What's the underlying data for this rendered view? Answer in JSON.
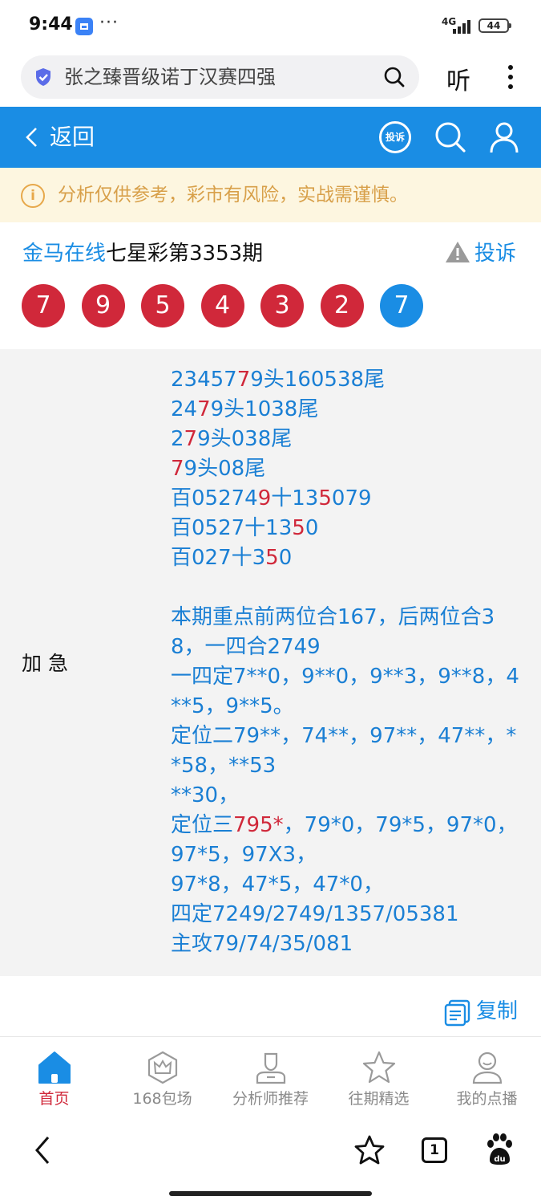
{
  "status_bar": {
    "time": "9:44",
    "dots": "···",
    "network": "4G",
    "battery": "44"
  },
  "browser": {
    "search_text": "张之臻晋级诺丁汉赛四强",
    "listen_label": "听"
  },
  "header": {
    "back_label": "返回",
    "complain_badge": "投诉"
  },
  "notice": {
    "text": "分析仅供参考，彩市有风险，实战需谨慎。"
  },
  "issue": {
    "site": "金马在线",
    "title": "七星彩第3353期",
    "complain_label": "投诉"
  },
  "balls": [
    {
      "number": "7",
      "color": "red"
    },
    {
      "number": "9",
      "color": "red"
    },
    {
      "number": "5",
      "color": "red"
    },
    {
      "number": "4",
      "color": "red"
    },
    {
      "number": "3",
      "color": "red"
    },
    {
      "number": "2",
      "color": "red"
    },
    {
      "number": "7",
      "color": "blue"
    }
  ],
  "panel": {
    "label": "加急",
    "lines": [
      {
        "segments": [
          {
            "text": "23457",
            "red": false
          },
          {
            "text": "7",
            "red": true
          },
          {
            "text": "9头160538尾",
            "red": false
          }
        ]
      },
      {
        "segments": [
          {
            "text": "24",
            "red": false
          },
          {
            "text": "7",
            "red": true
          },
          {
            "text": "9头1038尾",
            "red": false
          }
        ]
      },
      {
        "segments": [
          {
            "text": "2",
            "red": false
          },
          {
            "text": "7",
            "red": true
          },
          {
            "text": "9头038尾",
            "red": false
          }
        ]
      },
      {
        "segments": [
          {
            "text": "7",
            "red": true
          },
          {
            "text": "9头08尾",
            "red": false
          }
        ]
      },
      {
        "segments": [
          {
            "text": "百05274",
            "red": false
          },
          {
            "text": "9",
            "red": true
          },
          {
            "text": "十13",
            "red": false
          },
          {
            "text": "5",
            "red": true
          },
          {
            "text": "079",
            "red": false
          }
        ]
      },
      {
        "segments": [
          {
            "text": "百0527十13",
            "red": false
          },
          {
            "text": "5",
            "red": true
          },
          {
            "text": "0",
            "red": false
          }
        ]
      },
      {
        "segments": [
          {
            "text": "百027十3",
            "red": false
          },
          {
            "text": "5",
            "red": true
          },
          {
            "text": "0",
            "red": false
          }
        ]
      },
      {
        "segments": []
      },
      {
        "segments": [
          {
            "text": "本期重点前两位合167，后两位合3",
            "red": false
          }
        ]
      },
      {
        "segments": [
          {
            "text": "8，一四合2749",
            "red": false
          }
        ]
      },
      {
        "segments": [
          {
            "text": "一四定7**0，9**0，9**3，9**8，4",
            "red": false
          }
        ]
      },
      {
        "segments": [
          {
            "text": "**5，9**5。",
            "red": false
          }
        ]
      },
      {
        "segments": [
          {
            "text": "定位二79**，74**，97**，47**，*",
            "red": false
          }
        ]
      },
      {
        "segments": [
          {
            "text": "*58，**53",
            "red": false
          }
        ]
      },
      {
        "segments": [
          {
            "text": "**30，",
            "red": false
          }
        ]
      },
      {
        "segments": [
          {
            "text": "定位三",
            "red": false
          },
          {
            "text": "795*",
            "red": true
          },
          {
            "text": "，79*0，79*5，97*0，",
            "red": false
          }
        ]
      },
      {
        "segments": [
          {
            "text": "97*5，97X3，",
            "red": false
          }
        ]
      },
      {
        "segments": [
          {
            "text": "97*8，47*5，47*0，",
            "red": false
          }
        ]
      },
      {
        "segments": [
          {
            "text": "四定7249/2749/1357/05381",
            "red": false
          }
        ]
      },
      {
        "segments": [
          {
            "text": "主攻79/74/35/081",
            "red": false
          }
        ]
      }
    ]
  },
  "copy_label": "复制",
  "bottom_nav": [
    {
      "label": "首页",
      "icon": "home-icon",
      "active": true
    },
    {
      "label": "168包场",
      "icon": "crown-hexagon-icon",
      "active": false
    },
    {
      "label": "分析师推荐",
      "icon": "analyst-icon",
      "active": false
    },
    {
      "label": "往期精选",
      "icon": "star-icon",
      "active": false
    },
    {
      "label": "我的点播",
      "icon": "profile-icon",
      "active": false
    }
  ],
  "browser_bar": {
    "tabs_count": "1"
  },
  "colors": {
    "primary_blue": "#1a8de4",
    "ball_red": "#d0283a",
    "notice_bg": "#fdf6e0",
    "notice_text": "#d8a04a"
  }
}
